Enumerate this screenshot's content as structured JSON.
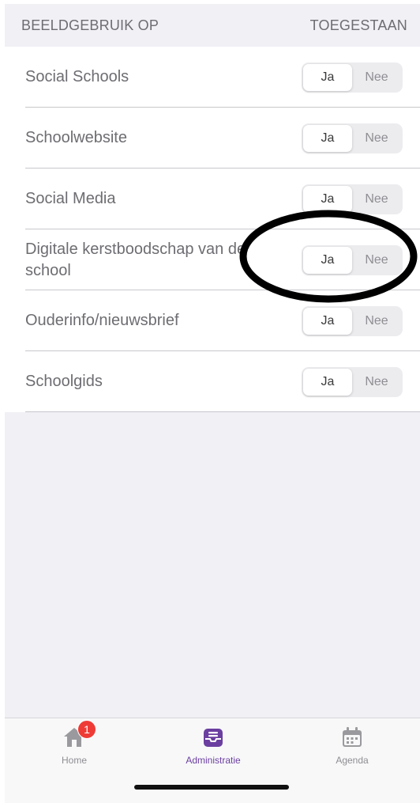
{
  "header": {
    "left": "BEELDGEBRUIK OP",
    "right": "TOEGESTAAN"
  },
  "rows": [
    {
      "label": "Social Schools",
      "yes": "Ja",
      "no": "Nee",
      "selected": "Ja"
    },
    {
      "label": "Schoolwebsite",
      "yes": "Ja",
      "no": "Nee",
      "selected": "Ja"
    },
    {
      "label": "Social Media",
      "yes": "Ja",
      "no": "Nee",
      "selected": "Ja"
    },
    {
      "label": "Digitale kerstboodschap van de school",
      "yes": "Ja",
      "no": "Nee",
      "selected": "Ja"
    },
    {
      "label": "Ouderinfo/nieuwsbrief",
      "yes": "Ja",
      "no": "Nee",
      "selected": "Ja"
    },
    {
      "label": "Schoolgids",
      "yes": "Ja",
      "no": "Nee",
      "selected": "Ja"
    }
  ],
  "tabbar": {
    "home": {
      "label": "Home",
      "badge": "1",
      "icon": "home-icon"
    },
    "administratie": {
      "label": "Administratie",
      "icon": "inbox-tray-icon",
      "active": true
    },
    "agenda": {
      "label": "Agenda",
      "icon": "calendar-icon"
    }
  },
  "colors": {
    "accent": "#6b3fa0",
    "badge": "#ef3b36",
    "background": "#f1f0f5",
    "text_secondary": "#6d6d72"
  }
}
